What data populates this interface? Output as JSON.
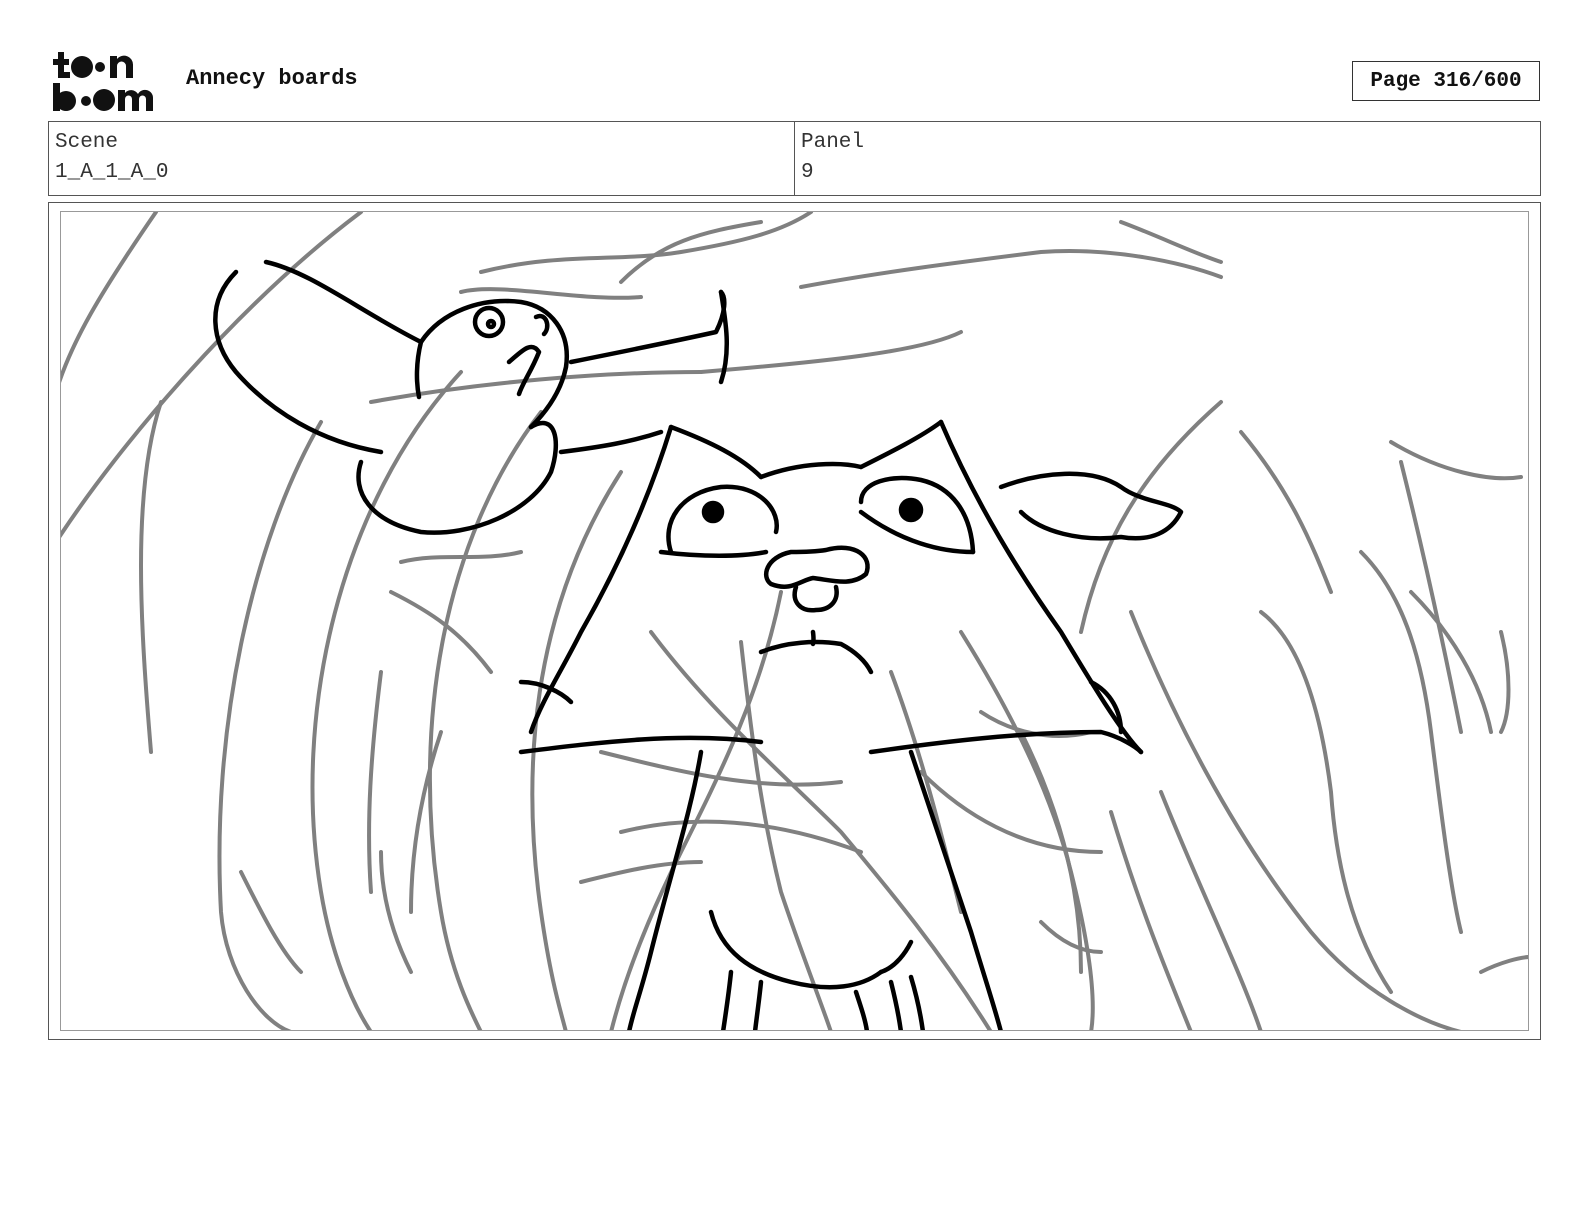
{
  "header": {
    "logo_text": "toon boom",
    "project_title": "Annecy boards",
    "page_label": "Page 316/600"
  },
  "info": {
    "scene_label": "Scene",
    "scene_value": "1_A_1_A_0",
    "panel_label": "Panel",
    "panel_value": "9"
  },
  "colors": {
    "rough_stroke": "#808080",
    "ink_stroke": "#000000",
    "border": "#555555"
  }
}
